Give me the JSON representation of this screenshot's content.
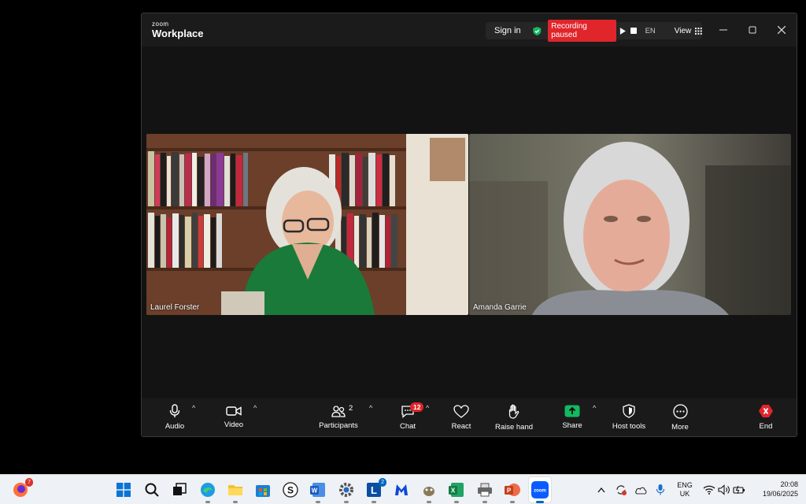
{
  "window": {
    "logo_small": "zoom",
    "logo_big": "Workplace",
    "sign_in": "Sign in",
    "recording_status": "Recording paused",
    "language": "EN",
    "view_label": "View"
  },
  "participants_tiles": [
    {
      "name": "Laurel Forster"
    },
    {
      "name": "Amanda Garrie"
    }
  ],
  "toolbar": {
    "audio": "Audio",
    "video": "Video",
    "participants": "Participants",
    "participants_count": "2",
    "chat": "Chat",
    "chat_badge": "12",
    "react": "React",
    "raise_hand": "Raise hand",
    "share": "Share",
    "host_tools": "Host tools",
    "more": "More",
    "end": "End"
  },
  "taskbar": {
    "firefox_badge": "7",
    "lync_badge": "2",
    "language": "ENG",
    "region": "UK",
    "time": "20:08",
    "date": "19/06/2025"
  },
  "colors": {
    "recording_red": "#e0252b",
    "share_green": "#13b85f",
    "end_red": "#e0252b"
  }
}
